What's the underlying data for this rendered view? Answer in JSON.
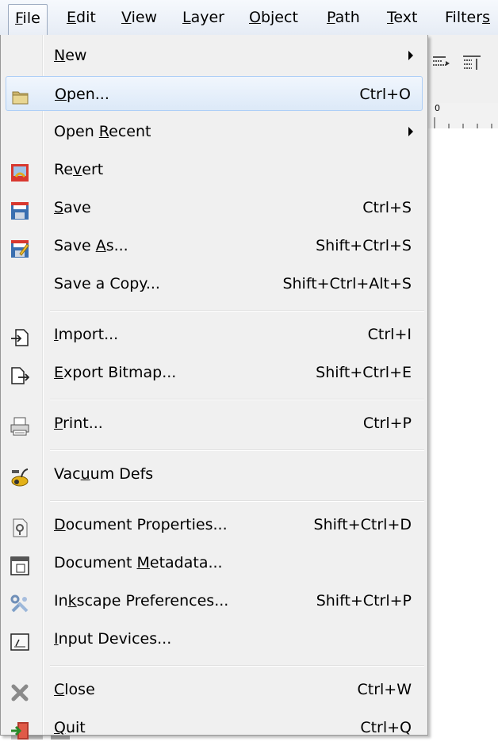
{
  "menubar": {
    "items": [
      {
        "label": "File",
        "key_index": 0
      },
      {
        "label": "Edit",
        "key_index": 0
      },
      {
        "label": "View",
        "key_index": 0
      },
      {
        "label": "Layer",
        "key_index": 0
      },
      {
        "label": "Object",
        "key_index": 0
      },
      {
        "label": "Path",
        "key_index": 0
      },
      {
        "label": "Text",
        "key_index": 0
      },
      {
        "label": "Filters",
        "key_index": 6
      }
    ]
  },
  "menu": {
    "items": [
      {
        "label": "New",
        "key_index": 0,
        "shortcut": "",
        "submenu": true,
        "icon": "none"
      },
      {
        "label": "Open...",
        "key_index": 0,
        "shortcut": "Ctrl+O",
        "submenu": false,
        "icon": "folder-icon",
        "hover": true
      },
      {
        "label": "Open Recent",
        "key_index": 5,
        "shortcut": "",
        "submenu": true,
        "icon": "none"
      },
      {
        "label": "Revert",
        "key_index": 2,
        "shortcut": "",
        "submenu": false,
        "icon": "revert-icon"
      },
      {
        "label": "Save",
        "key_index": 0,
        "shortcut": "Ctrl+S",
        "submenu": false,
        "icon": "save-icon"
      },
      {
        "label": "Save As...",
        "key_index": 5,
        "shortcut": "Shift+Ctrl+S",
        "submenu": false,
        "icon": "save-as-icon"
      },
      {
        "label": "Save a Copy...",
        "key_index": -1,
        "shortcut": "Shift+Ctrl+Alt+S",
        "submenu": false,
        "icon": "none"
      },
      {
        "separator": true
      },
      {
        "label": "Import...",
        "key_index": 0,
        "shortcut": "Ctrl+I",
        "submenu": false,
        "icon": "import-icon"
      },
      {
        "label": "Export Bitmap...",
        "key_index": 0,
        "shortcut": "Shift+Ctrl+E",
        "submenu": false,
        "icon": "export-icon"
      },
      {
        "separator": true
      },
      {
        "label": "Print...",
        "key_index": 0,
        "shortcut": "Ctrl+P",
        "submenu": false,
        "icon": "printer-icon"
      },
      {
        "separator": true
      },
      {
        "label": "Vacuum Defs",
        "key_index": 3,
        "shortcut": "",
        "submenu": false,
        "icon": "vacuum-icon"
      },
      {
        "separator": true
      },
      {
        "label": "Document Properties...",
        "key_index": 0,
        "shortcut": "Shift+Ctrl+D",
        "submenu": false,
        "icon": "document-properties-icon"
      },
      {
        "label": "Document Metadata...",
        "key_index": 9,
        "shortcut": "",
        "submenu": false,
        "icon": "metadata-icon"
      },
      {
        "label": "Inkscape Preferences...",
        "key_index": 2,
        "shortcut": "Shift+Ctrl+P",
        "submenu": false,
        "icon": "preferences-icon"
      },
      {
        "label": "Input Devices...",
        "key_index": 0,
        "shortcut": "",
        "submenu": false,
        "icon": "input-devices-icon"
      },
      {
        "separator": true
      },
      {
        "label": "Close",
        "key_index": 0,
        "shortcut": "Ctrl+W",
        "submenu": false,
        "icon": "close-icon"
      },
      {
        "label": "Quit",
        "key_index": 0,
        "shortcut": "Ctrl+Q",
        "submenu": false,
        "icon": "quit-icon"
      }
    ]
  },
  "ruler": {
    "origin_label": "0"
  },
  "colors": {
    "menu_bg": "#f0f0f0",
    "hover_border": "#aecff7",
    "menubar_active_border": "#9aa9bf"
  }
}
